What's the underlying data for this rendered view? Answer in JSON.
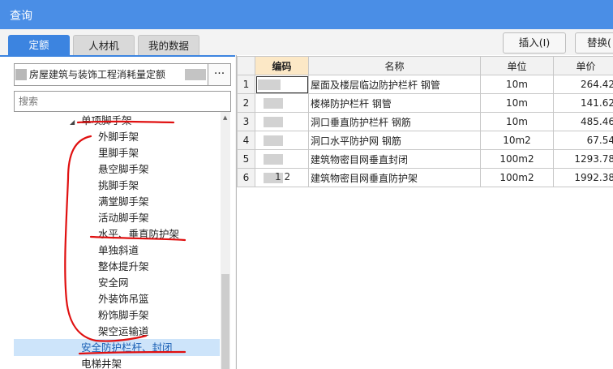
{
  "window": {
    "title": "查询"
  },
  "tabs": [
    {
      "label": "定额",
      "active": true
    },
    {
      "label": "人材机",
      "active": false
    },
    {
      "label": "我的数据",
      "active": false
    }
  ],
  "toolbar": {
    "insert_label": "插入(I)",
    "replace_label": "替换("
  },
  "library": {
    "name": "房屋建筑与装饰工程消耗量定额",
    "more_label": "···"
  },
  "search": {
    "placeholder": "搜索"
  },
  "tree": {
    "parent": "单项脚手架",
    "children": [
      "外脚手架",
      "里脚手架",
      "悬空脚手架",
      "挑脚手架",
      "满堂脚手架",
      "活动脚手架",
      "水平、垂直防护架",
      "单独斜道",
      "整体提升架",
      "安全网",
      "外装饰吊篮",
      "粉饰脚手架",
      "架空运输道"
    ],
    "selected": "安全防护栏杆、封闭",
    "next": "电梯井架"
  },
  "grid": {
    "headers": {
      "code": "编码",
      "name": "名称",
      "unit": "单位",
      "price": "单价"
    },
    "rows": [
      {
        "no": "1",
        "code": "",
        "name": "屋面及楼层临边防护栏杆 钢管",
        "unit": "10m",
        "price": "264.42"
      },
      {
        "no": "2",
        "code": "",
        "name": "楼梯防护栏杆 钢管",
        "unit": "10m",
        "price": "141.62"
      },
      {
        "no": "3",
        "code": "",
        "name": "洞口垂直防护栏杆 钢筋",
        "unit": "10m",
        "price": "485.46"
      },
      {
        "no": "4",
        "code": "",
        "name": "洞口水平防护网 钢筋",
        "unit": "10m2",
        "price": "67.54"
      },
      {
        "no": "5",
        "code": "",
        "name": "建筑物密目网垂直封闭",
        "unit": "100m2",
        "price": "1293.78"
      },
      {
        "no": "6",
        "code": "1  2",
        "name": "建筑物密目网垂直防护架",
        "unit": "100m2",
        "price": "1992.38"
      }
    ]
  },
  "colors": {
    "titlebar": "#4a8ee6",
    "active_tab": "#3c84e0",
    "selected_row": "#cde4fa",
    "annotation": "#e01010",
    "code_header": "#fce8c6"
  }
}
